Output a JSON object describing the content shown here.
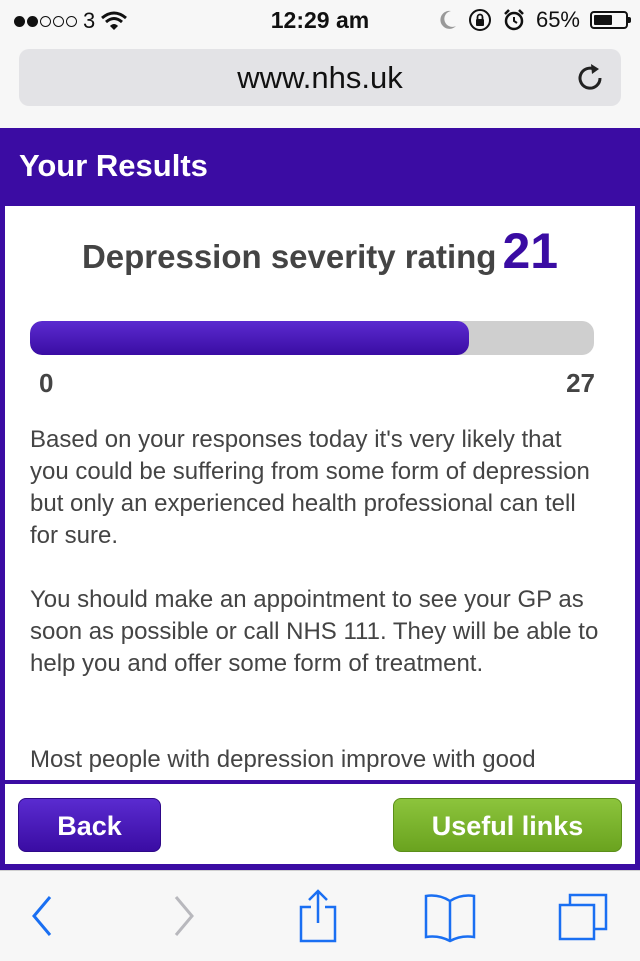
{
  "status_bar": {
    "carrier": "3",
    "time": "12:29 am",
    "battery_percent": "65%",
    "battery_level": 0.65,
    "signal_bars_filled": 2,
    "signal_bars_total": 5,
    "icons": [
      "wifi-icon",
      "moon-icon",
      "rotation-lock-icon",
      "alarm-icon",
      "battery-icon"
    ]
  },
  "browser": {
    "url": "www.nhs.uk",
    "reload_icon": "reload-icon",
    "toolbar_icons": [
      "back-icon",
      "forward-icon",
      "share-icon",
      "bookmarks-icon",
      "tabs-icon"
    ]
  },
  "page": {
    "header_title": "Your Results",
    "rating_label": "Depression severity rating",
    "rating_value": "21",
    "scale_min": "0",
    "scale_max": "27",
    "rating_fraction": 0.7778,
    "paragraphs": [
      "Based on your responses today it's very likely that you could be suffering from some form of depression but only an experienced health professional can tell for sure.",
      "You should make an appointment to see your GP as soon as possible or call NHS 111. They will be able to help you and offer some form of treatment.",
      "Most people with depression improve with good"
    ],
    "buttons": {
      "back": "Back",
      "useful_links": "Useful links"
    }
  },
  "colors": {
    "nhs_purple": "#3a0ca3",
    "green_button": "#7ab52e",
    "text": "#444444"
  }
}
